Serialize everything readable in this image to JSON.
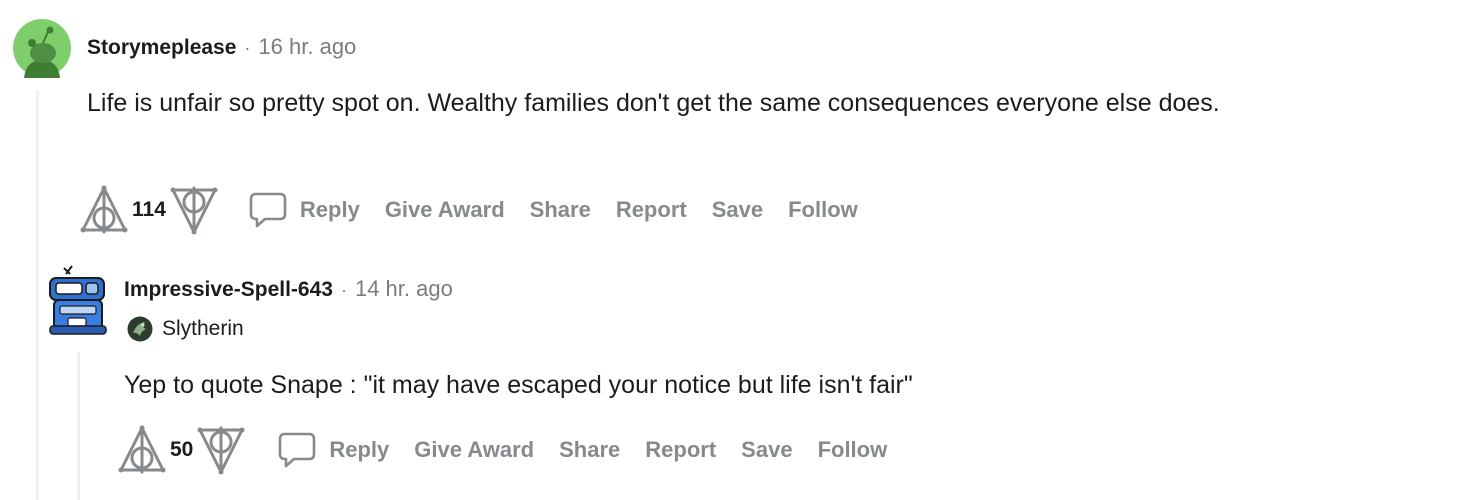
{
  "comments": [
    {
      "author": "Storymeplease",
      "separator": "·",
      "time": "16 hr. ago",
      "avatar_icon": "snoo-avatar-icon",
      "body": "Life is unfair so pretty spot on. Wealthy families don't get the same consequences everyone else does.",
      "score": "114",
      "actions": {
        "reply": "Reply",
        "give_award": "Give Award",
        "share": "Share",
        "report": "Report",
        "save": "Save",
        "follow": "Follow"
      }
    },
    {
      "author": "Impressive-Spell-643",
      "separator": "·",
      "time": "14 hr. ago",
      "avatar_icon": "robot-avatar-icon",
      "flair": "Slytherin",
      "flair_icon": "slytherin-crest-icon",
      "body": "Yep to quote Snape : \"it may have escaped your notice but life isn't fair\"",
      "score": "50",
      "actions": {
        "reply": "Reply",
        "give_award": "Give Award",
        "share": "Share",
        "report": "Report",
        "save": "Save",
        "follow": "Follow"
      }
    }
  ],
  "colors": {
    "action_gray": "#878a8c",
    "thread_line": "#edeff1",
    "avatar_green": "#7ecf6b"
  }
}
